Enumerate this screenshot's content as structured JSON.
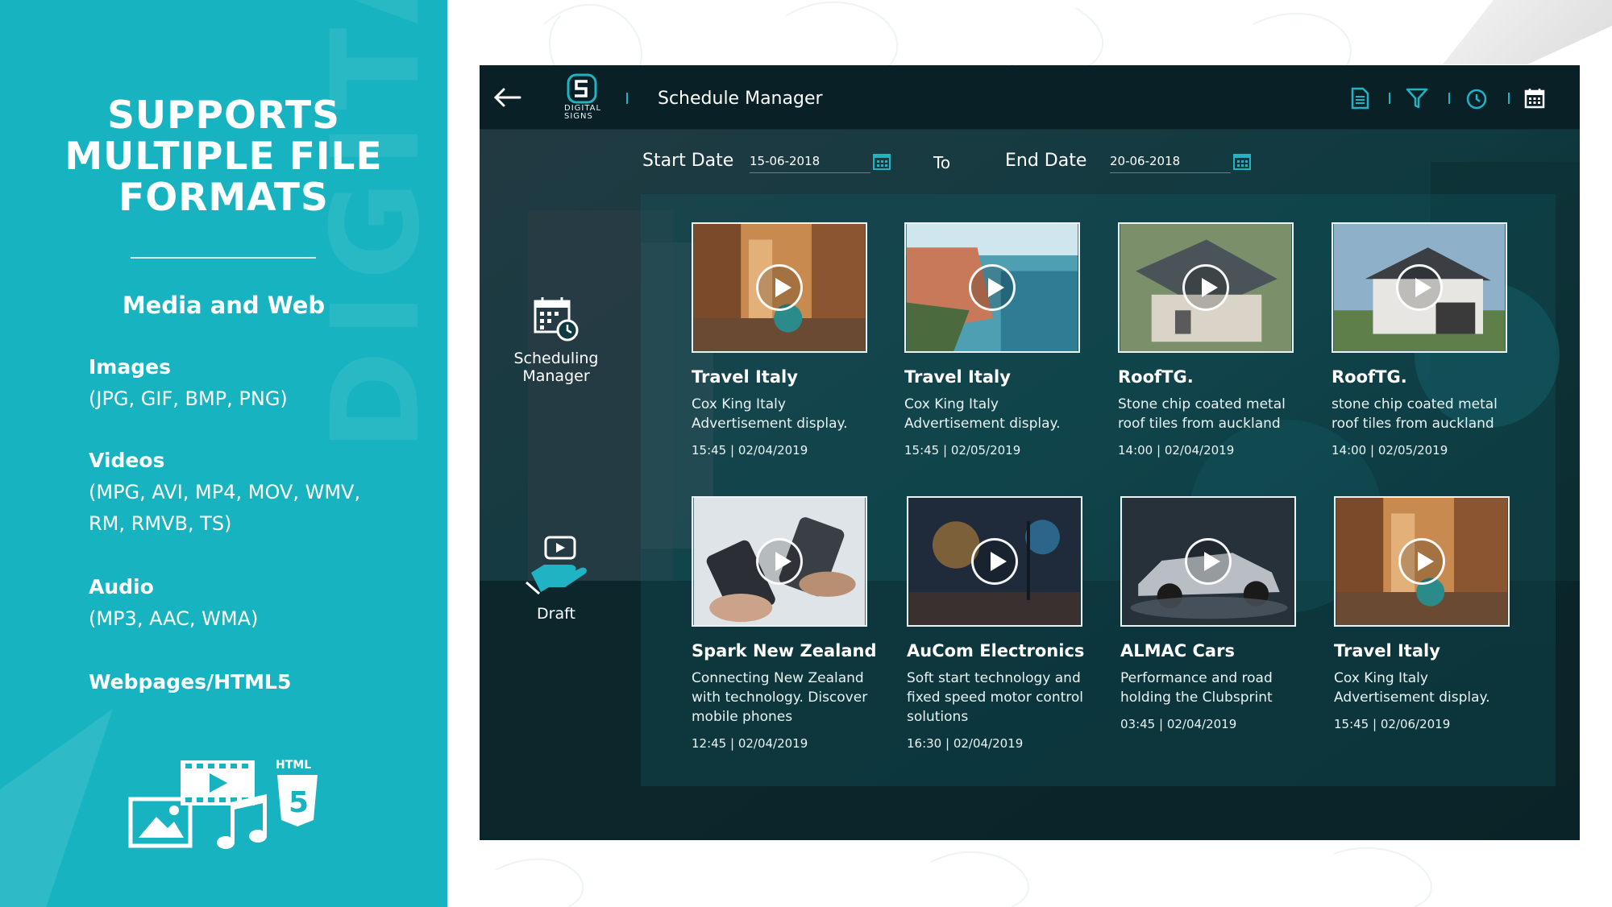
{
  "promo": {
    "title_lines": [
      "SUPPORTS",
      "MULTIPLE FILE",
      "FORMATS"
    ],
    "subtitle": "Media and Web",
    "watermark": "DIGITALSIG",
    "formats": [
      {
        "heading": "Images",
        "body": "(JPG, GIF, BMP, PNG)"
      },
      {
        "heading": "Videos",
        "body": "(MPG, AVI, MP4, MOV, WMV, RM, RMVB, TS)"
      },
      {
        "heading": "Audio",
        "body": "(MP3, AAC, WMA)"
      },
      {
        "heading": "Webpages/HTML5",
        "body": ""
      }
    ],
    "html_badge": "HTML",
    "html_number": "5"
  },
  "app": {
    "logo_text": "DIGITAL SIGNS",
    "title": "Schedule Manager",
    "toolbar_icons": [
      "document-icon",
      "filter-icon",
      "clock-icon",
      "calendar-icon"
    ],
    "accent_color": "#1fb3c3",
    "dates": {
      "start_label": "Start Date",
      "start_value": "15-06-2018",
      "to_label": "To",
      "end_label": "End Date",
      "end_value": "20-06-2018"
    },
    "sidebar": {
      "scheduling_label": "Scheduling Manager",
      "draft_label": "Draft"
    },
    "cards": [
      {
        "title": "Travel Italy",
        "description": "Cox King Italy Advertisement display.",
        "time": "15:45 | 02/04/2019",
        "thumb": "street"
      },
      {
        "title": "Travel Italy",
        "description": "Cox King Italy Advertisement display.",
        "time": "15:45 | 02/05/2019",
        "thumb": "coast"
      },
      {
        "title": "RoofTG.",
        "description": "Stone chip coated metal roof tiles from auckland",
        "time": "14:00 | 02/04/2019",
        "thumb": "roof"
      },
      {
        "title": "RoofTG.",
        "description": "stone chip coated metal roof tiles from auckland",
        "time": "14:00 | 02/05/2019",
        "thumb": "house"
      },
      {
        "title": "Spark New Zealand",
        "description": "Connecting New Zealand with technology. Discover mobile phones",
        "time": "12:45 | 02/04/2019",
        "thumb": "phones"
      },
      {
        "title": "AuCom Electronics",
        "description": "Soft start technology and fixed speed motor control solutions",
        "time": "16:30 | 02/04/2019",
        "thumb": "night"
      },
      {
        "title": "ALMAC Cars",
        "description": "Performance and road holding the Clubsprint",
        "time": "03:45 | 02/04/2019",
        "thumb": "car"
      },
      {
        "title": "Travel Italy",
        "description": "Cox King Italy Advertisement display.",
        "time": "15:45 | 02/06/2019",
        "thumb": "street"
      }
    ]
  }
}
